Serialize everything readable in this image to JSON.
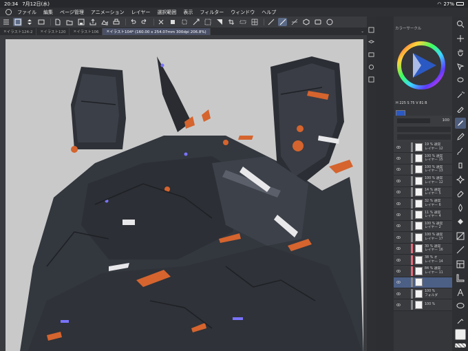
{
  "status": {
    "time": "20:34",
    "date": "7月12日(水)",
    "battery": "27%"
  },
  "menu": [
    "ファイル",
    "編集",
    "ページ管理",
    "アニメーション",
    "レイヤー",
    "選択範囲",
    "表示",
    "フィルター",
    "ウィンドウ",
    "ヘルプ"
  ],
  "tabs": [
    {
      "label": "イラスト124-2"
    },
    {
      "label": "イラスト120"
    },
    {
      "label": "イラスト106"
    },
    {
      "label": "イラスト104* (160.00 x 254.07mm 300dpi 206.8%)"
    }
  ],
  "color_panel": {
    "title": "カラーサークル",
    "hsv": "H 225  S 75  V 81  B"
  },
  "layer_top": {
    "opacity": "100"
  },
  "layers": [
    {
      "line1": "19 %  通常",
      "line2": "レイヤー 12",
      "bar": "#888"
    },
    {
      "line1": "100 %  通常",
      "line2": "レイヤー 15",
      "bar": "#888"
    },
    {
      "line1": "100 %  通常",
      "line2": "レイヤー 13",
      "bar": "#888"
    },
    {
      "line1": "100 %  通常",
      "line2": "レイヤー 12",
      "bar": "#888"
    },
    {
      "line1": "14 %  通常",
      "line2": "レイヤー 5",
      "bar": "#888"
    },
    {
      "line1": "32 %  通常",
      "line2": "レイヤー 6",
      "bar": "#888"
    },
    {
      "line1": "11 %  通常",
      "line2": "レイヤー 4",
      "bar": "#888"
    },
    {
      "line1": "100 %  通常",
      "line2": "レイヤー 2",
      "bar": "#888"
    },
    {
      "line1": "100 %  通常",
      "line2": "レイヤー 17",
      "bar": "#888"
    },
    {
      "line1": "30 %  通常",
      "line2": "レイヤー 16",
      "bar": "#e46a7a"
    },
    {
      "line1": "38 %  オ",
      "line2": "レイヤー 14",
      "bar": "#e46a7a"
    },
    {
      "line1": "84 %  通常",
      "line2": "レイヤー 11",
      "bar": "#e46a7a"
    },
    {
      "line1": "",
      "line2": "",
      "bar": "#888",
      "selected": true
    },
    {
      "line1": "100 %",
      "line2": "フォルダ",
      "bar": "#888"
    },
    {
      "line1": "100 %",
      "line2": "",
      "bar": "#888"
    }
  ]
}
